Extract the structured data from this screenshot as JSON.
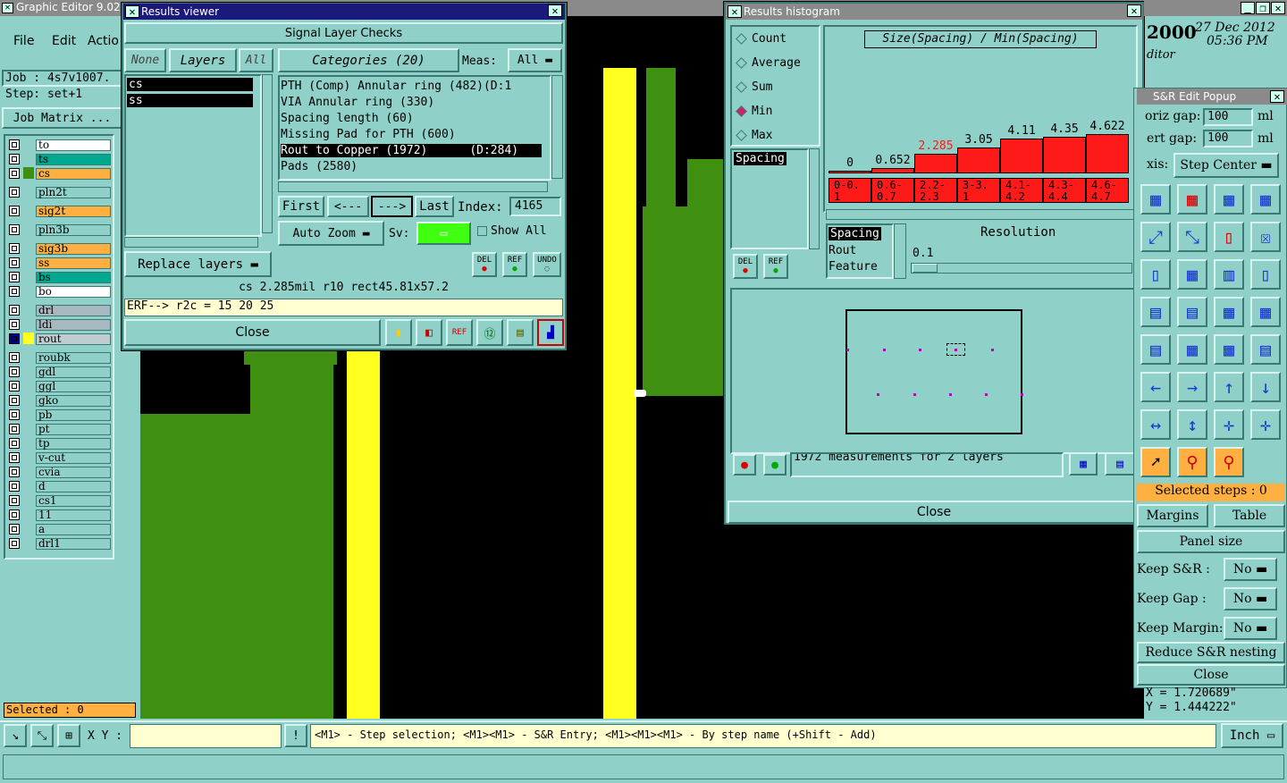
{
  "main": {
    "title": "Graphic Editor 9.02c",
    "menu": [
      "File",
      "Edit",
      "Actio"
    ],
    "job": "Job : 4s7v1007.",
    "step": "Step: set+1",
    "job_matrix": "Job Matrix ...",
    "layers": [
      {
        "name": "to",
        "color": "#ffffff"
      },
      {
        "name": "ts",
        "color": "#00a890"
      },
      {
        "name": "cs",
        "color": "#ffb040"
      },
      {
        "name": "pln2t",
        "color": "#8fd0c8"
      },
      {
        "name": "sig2t",
        "color": "#ffb040"
      },
      {
        "name": "pln3b",
        "color": "#8fd0c8"
      },
      {
        "name": "sig3b",
        "color": "#ffb040"
      },
      {
        "name": "ss",
        "color": "#ffb040"
      },
      {
        "name": "bs",
        "color": "#00a890"
      },
      {
        "name": "bo",
        "color": "#ffffff"
      },
      {
        "name": "drl",
        "color": "#a8b8c0"
      },
      {
        "name": "ldi",
        "color": "#a8b8c0"
      },
      {
        "name": "rout",
        "color": "#c0ccd0"
      },
      {
        "name": "roubk",
        "color": "#8fd0c8"
      },
      {
        "name": "gdl",
        "color": "#8fd0c8"
      },
      {
        "name": "ggl",
        "color": "#8fd0c8"
      },
      {
        "name": "gko",
        "color": "#8fd0c8"
      },
      {
        "name": "pb",
        "color": "#8fd0c8"
      },
      {
        "name": "pt",
        "color": "#8fd0c8"
      },
      {
        "name": "tp",
        "color": "#8fd0c8"
      },
      {
        "name": "v-cut",
        "color": "#8fd0c8"
      },
      {
        "name": "cvia",
        "color": "#8fd0c8"
      },
      {
        "name": "d",
        "color": "#8fd0c8"
      },
      {
        "name": "cs1",
        "color": "#8fd0c8"
      },
      {
        "name": "11",
        "color": "#8fd0c8"
      },
      {
        "name": "a",
        "color": "#8fd0c8"
      },
      {
        "name": "drl1",
        "color": "#8fd0c8"
      }
    ],
    "selected": "Selected : 0",
    "xy_label": "X Y :",
    "status_hint": "<M1> - Step selection; <M1><M1> - S&R Entry; <M1><M1><M1> - By step name (+Shift - Add)",
    "units": "Inch",
    "date_year": "2000",
    "date_day": "27 Dec 2012",
    "date_time": "05:36 PM",
    "editor_label": "ditor",
    "coord_x": "X = 1.720689\"",
    "coord_y": "Y = 1.444222\""
  },
  "results_viewer": {
    "title": "Results viewer",
    "header": "Signal Layer Checks",
    "none": "None",
    "layers": "Layers",
    "all": "All",
    "categories": "Categories (20)",
    "meas_label": "Meas:",
    "meas_value": "All",
    "layer_items": [
      "cs",
      "ss"
    ],
    "category_items": [
      "PTH (Comp) Annular ring (482)(D:1",
      "VIA Annular ring (330)",
      "Spacing length (60)",
      "Missing Pad for PTH (600)",
      "Rout to Copper (1972)      (D:284)",
      "Pads (2580)"
    ],
    "first": "First",
    "prev": "<---",
    "next": "--->",
    "last": "Last",
    "index_label": "Index:",
    "index_value": "4165",
    "auto_zoom": "Auto Zoom",
    "sv": "Sv:",
    "show_all": "Show All",
    "replace_layers": "Replace layers",
    "del": "DEL",
    "ref": "REF",
    "undo": "UNDO",
    "info": "cs 2.285mil  r10  rect45.81x57.2",
    "erf": "ERF--> r2c = 15 20 25",
    "close": "Close"
  },
  "histogram": {
    "title": "Results histogram",
    "options": [
      "Count",
      "Average",
      "Sum",
      "Min",
      "Max"
    ],
    "selected_option": "Min",
    "chart_title": "Size(Spacing) / Min(Spacing)",
    "list_item": "Spacing",
    "del": "DEL",
    "ref": "REF",
    "list2": [
      "Spacing",
      "Rout",
      "Feature"
    ],
    "resolution_label": "Resolution",
    "resolution_value": "0.1",
    "measurements": "1972 measurements for 2 layers",
    "close": "Close"
  },
  "chart_data": {
    "type": "bar",
    "title": "Size(Spacing) / Min(Spacing)",
    "categories": [
      "0-0.1",
      "0.6-0.7",
      "2.2-2.3",
      "3-3.1",
      "4.1-4.2",
      "4.3-4.4",
      "4.6-4.7"
    ],
    "values": [
      0,
      0.652,
      2.285,
      3.05,
      4.11,
      4.35,
      4.622
    ],
    "value_labels": [
      "0",
      "0.652",
      "2.285",
      "3.05",
      "4.11",
      "4.35",
      "4.622"
    ],
    "highlight_index": 2,
    "bar_color": "#ff1a1a",
    "highlight_label_color": "#ff1a1a"
  },
  "sr_popup": {
    "title": "S&R Edit Popup",
    "horiz_gap_label": "oriz gap:",
    "horiz_gap": "100",
    "vert_gap_label": "ert gap:",
    "vert_gap": "100",
    "unit": "ml",
    "axis_label": "xis:",
    "axis_value": "Step Center",
    "selected_steps": "Selected steps : 0",
    "margins": "Margins",
    "table": "Table",
    "panel_size": "Panel size",
    "keep_sr": "Keep S&R  :",
    "keep_gap": "Keep Gap   :",
    "keep_margin": "Keep Margin:",
    "no": "No",
    "reduce": "Reduce S&R nesting",
    "close": "Close"
  }
}
